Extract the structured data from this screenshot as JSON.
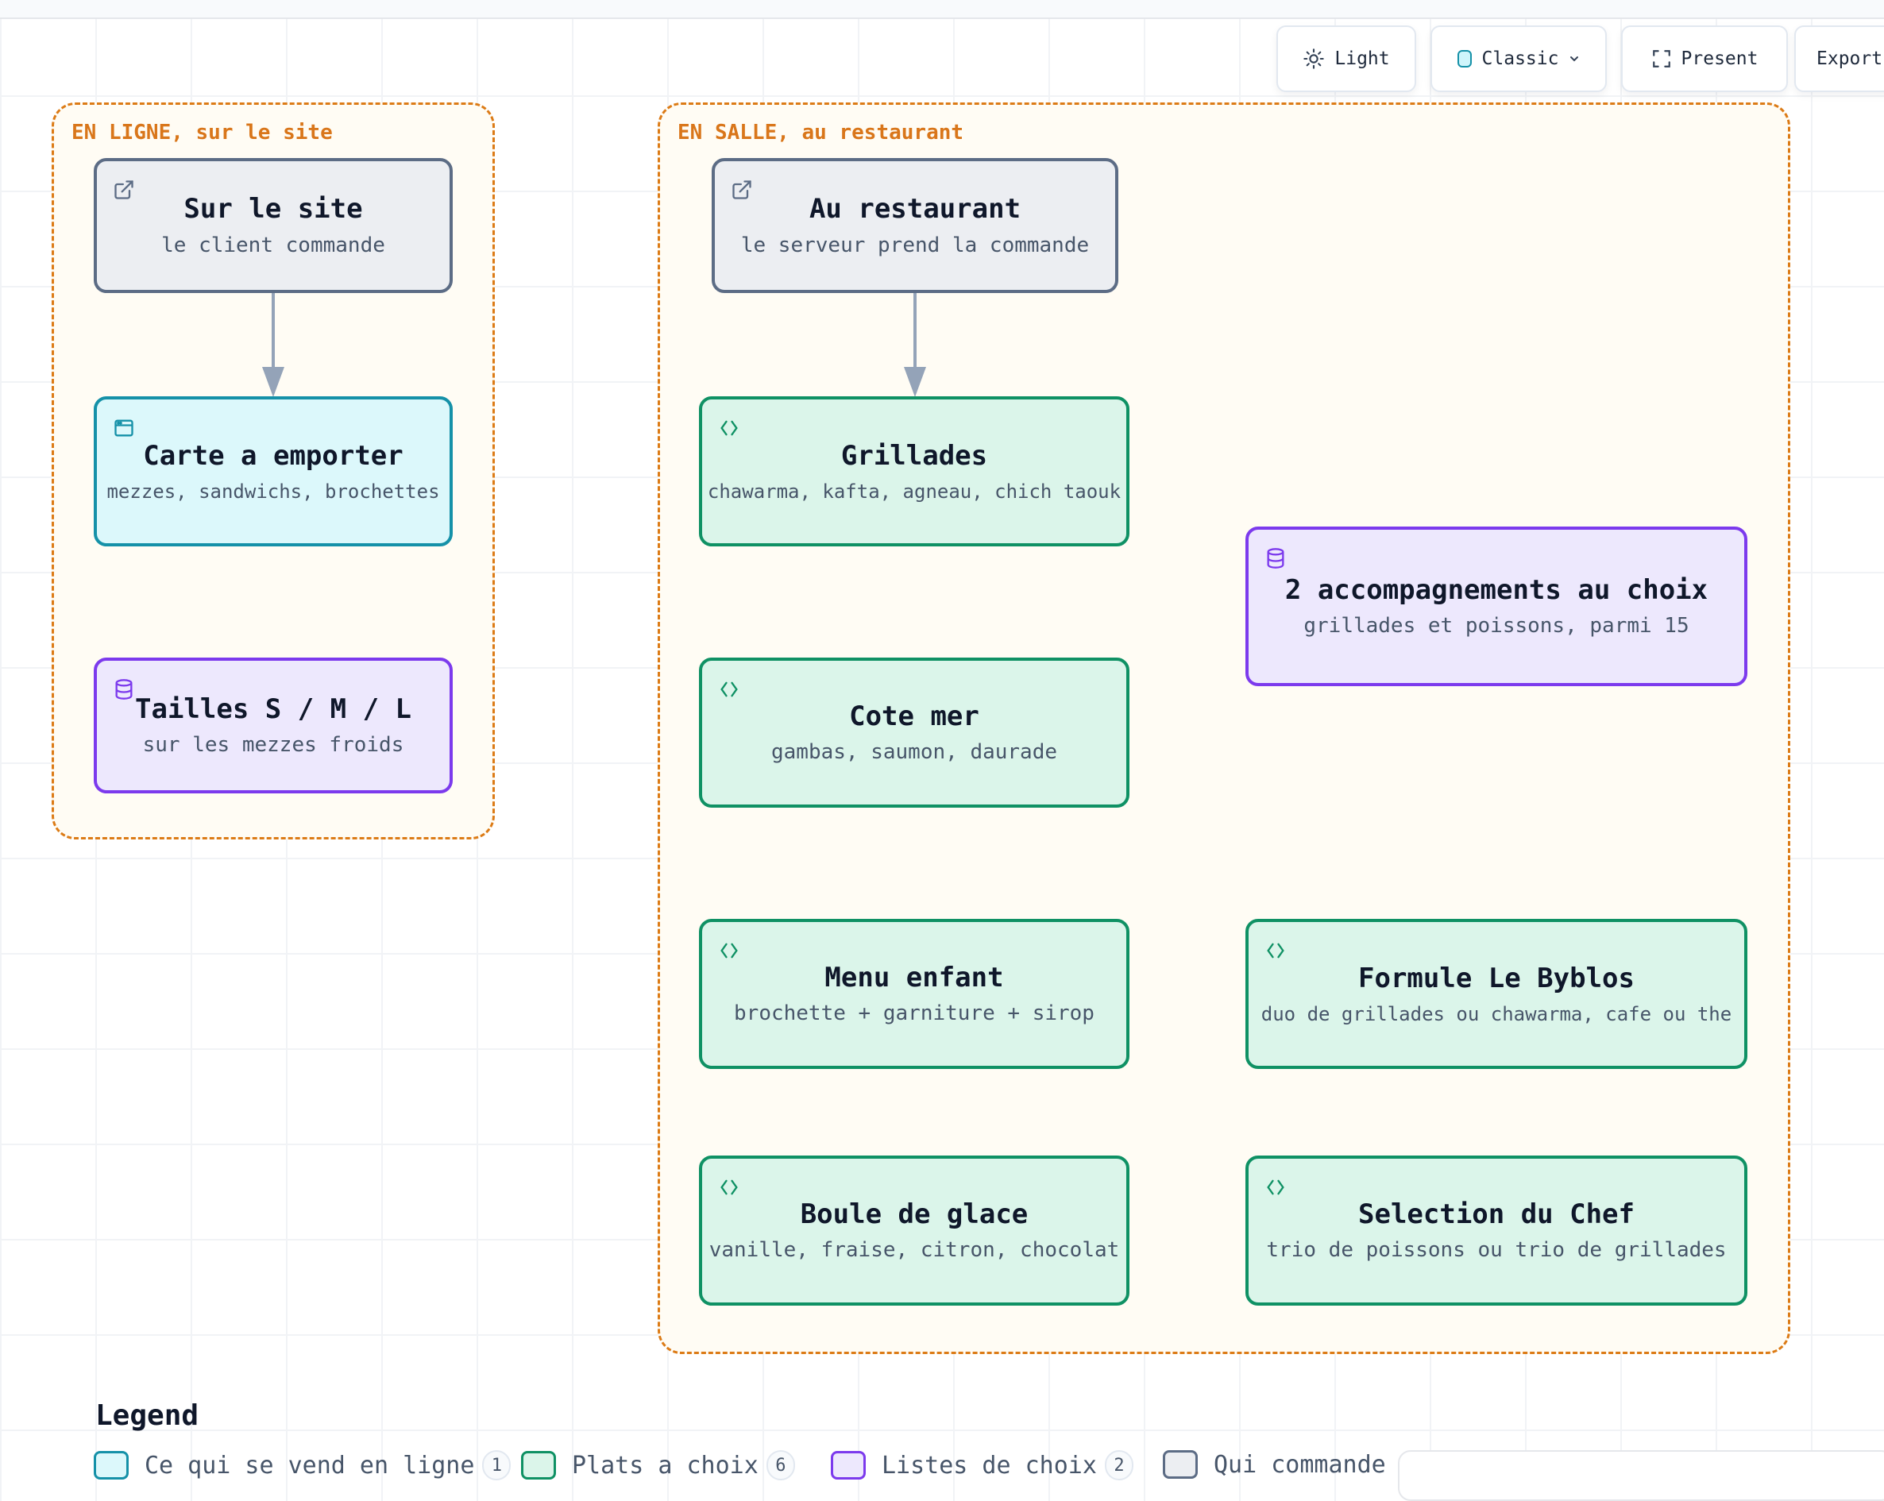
{
  "toolbar": {
    "theme_label": "Light",
    "theme_icon": "sun-icon",
    "style_label": "Classic",
    "style_icon": "cylinder-icon",
    "present_label": "Present",
    "present_icon": "fullscreen-icon",
    "export_label": "Export"
  },
  "groups": {
    "online": {
      "title": "EN LIGNE, sur le site"
    },
    "salle": {
      "title": "EN SALLE, au restaurant"
    }
  },
  "nodes": {
    "sur_le_site": {
      "title": "Sur le site",
      "subtitle": "le client commande",
      "icon": "external-link-icon"
    },
    "carte": {
      "title": "Carte a emporter",
      "subtitle": "mezzes, sandwichs, brochettes",
      "icon": "browser-window-icon"
    },
    "tailles": {
      "title": "Tailles S / M / L",
      "subtitle": "sur les mezzes froids",
      "icon": "database-icon"
    },
    "au_restaurant": {
      "title": "Au restaurant",
      "subtitle": "le serveur prend la commande",
      "icon": "external-link-icon"
    },
    "grillades": {
      "title": "Grillades",
      "subtitle": "chawarma, kafta, agneau, chich taouk",
      "icon": "code-brackets-icon"
    },
    "accompagnements": {
      "title": "2 accompagnements au choix",
      "subtitle": "grillades et poissons, parmi 15",
      "icon": "database-icon"
    },
    "cote_mer": {
      "title": "Cote mer",
      "subtitle": "gambas, saumon, daurade",
      "icon": "code-brackets-icon"
    },
    "menu_enfant": {
      "title": "Menu enfant",
      "subtitle": "brochette + garniture + sirop",
      "icon": "code-brackets-icon"
    },
    "formule": {
      "title": "Formule Le Byblos",
      "subtitle": "duo de grillades ou chawarma, cafe ou the",
      "icon": "code-brackets-icon"
    },
    "glace": {
      "title": "Boule de glace",
      "subtitle": "vanille, fraise, citron, chocolat",
      "icon": "code-brackets-icon"
    },
    "chef": {
      "title": "Selection du Chef",
      "subtitle": "trio de poissons ou trio de grillades",
      "icon": "code-brackets-icon"
    }
  },
  "edges": [
    {
      "from": "Sur le site",
      "to": "Carte a emporter"
    },
    {
      "from": "Au restaurant",
      "to": "Grillades"
    }
  ],
  "legend": {
    "title": "Legend",
    "items": [
      {
        "label": "Ce qui se vend en ligne",
        "count": "1",
        "color": "#1591a8"
      },
      {
        "label": "Plats a choix",
        "count": "6",
        "color": "#0f9164"
      },
      {
        "label": "Listes de choix",
        "count": "2",
        "color": "#7c3aed"
      },
      {
        "label": "Qui commande",
        "color": "#5c6c85"
      }
    ]
  },
  "colors": {
    "group_border": "#dc7b16",
    "gray_node": "#5c6c85",
    "cyan_node": "#1591a8",
    "purple_node": "#7c3aed",
    "green_node": "#0f9164",
    "edge": "#94a3b8"
  }
}
